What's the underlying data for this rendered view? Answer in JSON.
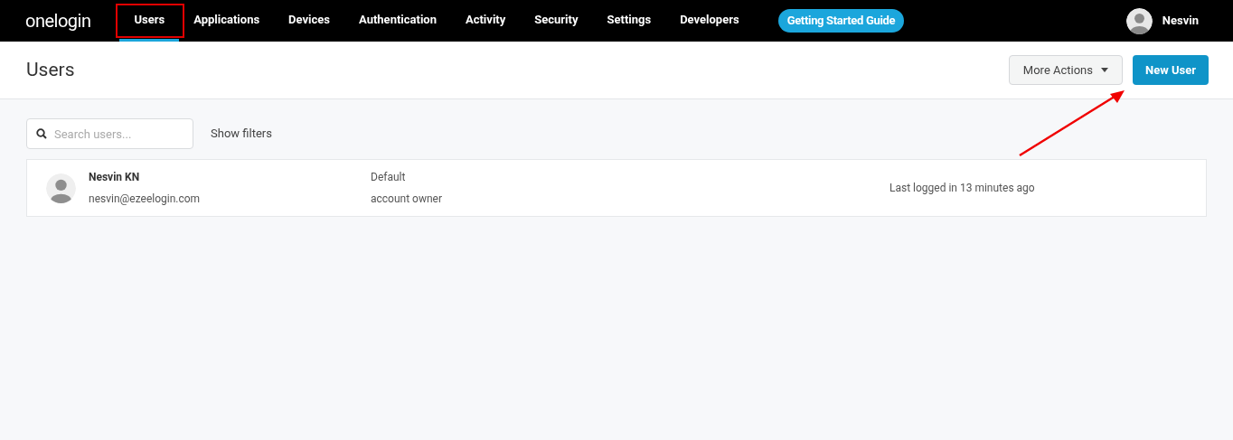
{
  "brand": "onelogin",
  "nav": [
    {
      "label": "Users",
      "selected": true
    },
    {
      "label": "Applications",
      "selected": false
    },
    {
      "label": "Devices",
      "selected": false
    },
    {
      "label": "Authentication",
      "selected": false
    },
    {
      "label": "Activity",
      "selected": false
    },
    {
      "label": "Security",
      "selected": false
    },
    {
      "label": "Settings",
      "selected": false
    },
    {
      "label": "Developers",
      "selected": false
    }
  ],
  "guide_button": "Getting Started Guide",
  "account": {
    "name": "Nesvin"
  },
  "page_title": "Users",
  "actions": {
    "more": "More Actions",
    "primary": "New User"
  },
  "search": {
    "placeholder": "Search users..."
  },
  "show_filters": "Show filters",
  "users": [
    {
      "name": "Nesvin KN",
      "email": "nesvin@ezeelogin.com",
      "role": "Default",
      "role_detail": "account owner",
      "last_login": "Last logged in 13 minutes ago"
    }
  ]
}
